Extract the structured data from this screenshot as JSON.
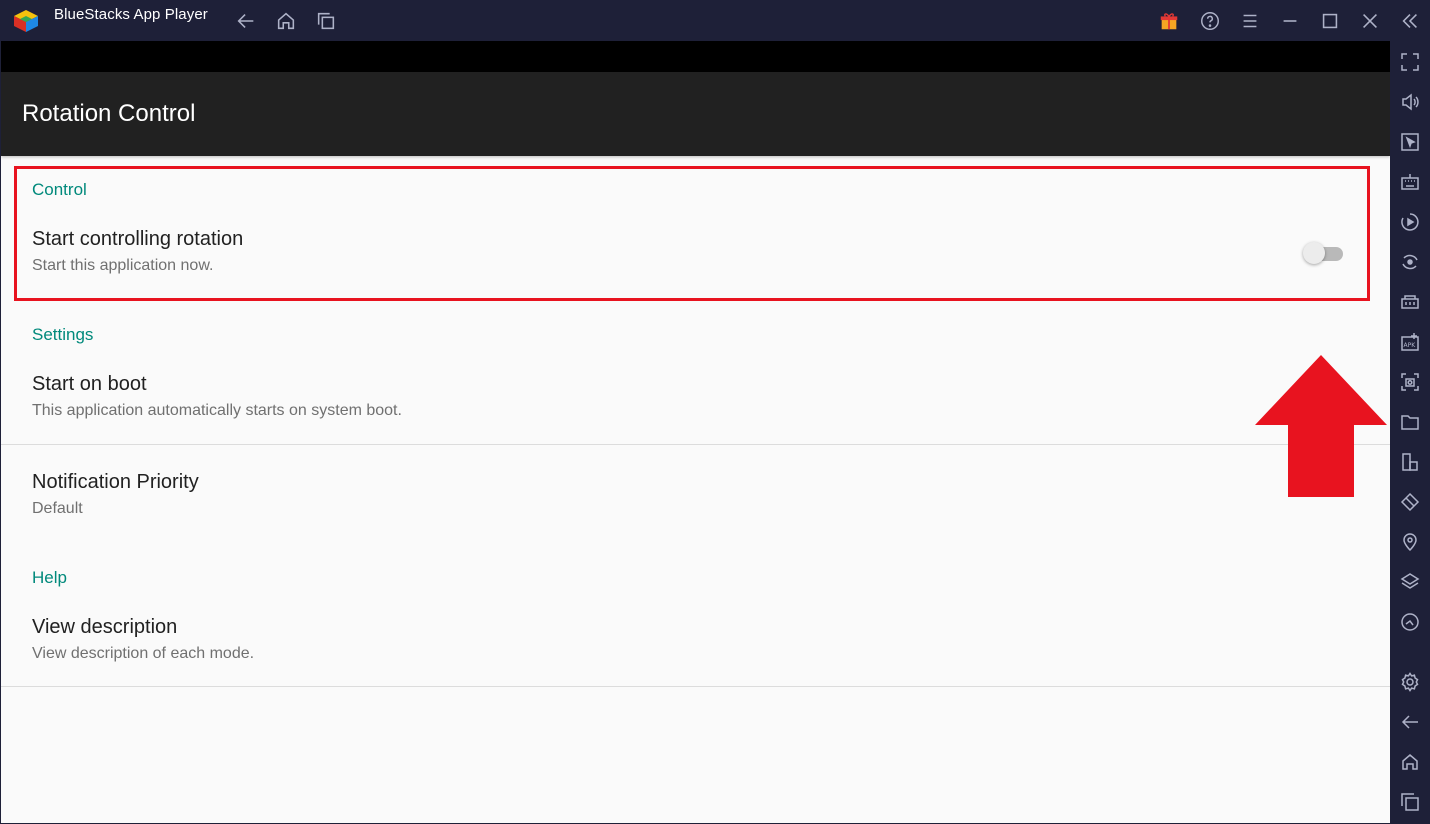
{
  "window": {
    "title": "BlueStacks App Player"
  },
  "appbar": {
    "title": "Rotation Control"
  },
  "sections": {
    "control": {
      "header": "Control",
      "start_rotation": {
        "title": "Start controlling rotation",
        "summary": "Start this application now.",
        "enabled": false
      }
    },
    "settings": {
      "header": "Settings",
      "start_on_boot": {
        "title": "Start on boot",
        "summary": "This application automatically starts on system boot."
      },
      "notification_priority": {
        "title": "Notification Priority",
        "summary": "Default"
      }
    },
    "help": {
      "header": "Help",
      "view_description": {
        "title": "View description",
        "summary": "View description of each mode."
      }
    }
  },
  "colors": {
    "accent": "#00897b",
    "highlight": "#e8131f",
    "appbar": "#212121",
    "chrome": "#1e2038"
  },
  "titlebar_icons": [
    "back-icon",
    "home-icon",
    "recent-apps-icon",
    "gift-icon",
    "help-icon",
    "menu-icon",
    "minimize-icon",
    "maximize-icon",
    "close-icon",
    "collapse-sidebar-icon"
  ],
  "sidebar_icons": [
    "fullscreen-icon",
    "volume-icon",
    "pointer-icon",
    "keyboard-icon",
    "macro-icon",
    "sync-icon",
    "performance-icon",
    "install-apk-icon",
    "screenshot-icon",
    "folder-icon",
    "multi-instance-icon",
    "rotate-icon",
    "location-icon",
    "layers-icon",
    "eco-mode-icon",
    "settings-icon",
    "back-icon",
    "home-icon",
    "recent-apps-icon"
  ]
}
